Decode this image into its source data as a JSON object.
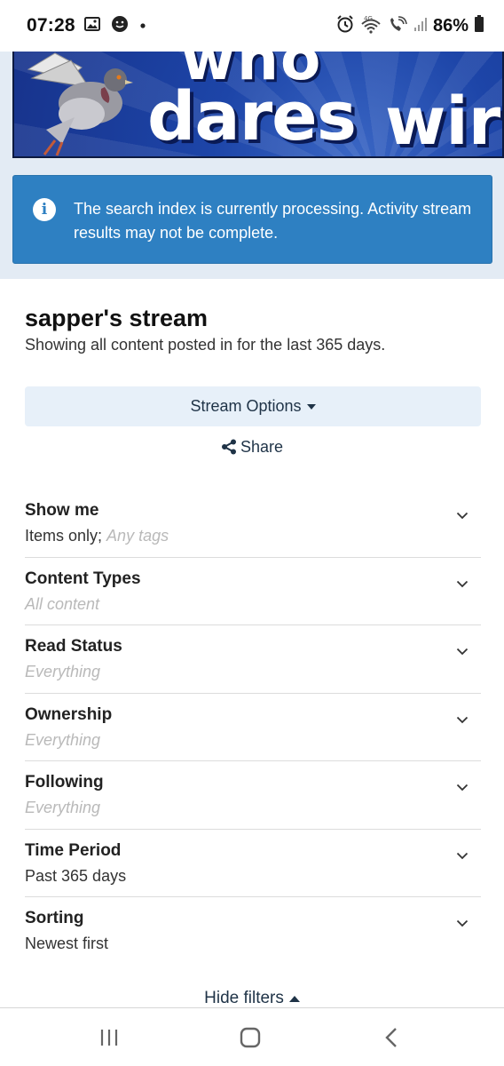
{
  "status_bar": {
    "time": "07:28",
    "battery": "86%",
    "network": "4G"
  },
  "banner": {
    "word_who": "who",
    "word_dares": "dares",
    "word_wins": "wir"
  },
  "alert": {
    "icon": "info-icon",
    "message": "The search index is currently processing. Activity stream results may not be complete.",
    "color": "#2e80c2"
  },
  "page": {
    "title": "sapper's stream",
    "subtitle": "Showing all content posted in for the last 365 days."
  },
  "actions": {
    "stream_options_label": "Stream Options",
    "share_label": "Share"
  },
  "filters": [
    {
      "label": "Show me",
      "value": "Items only;",
      "value_muted": "Any tags"
    },
    {
      "label": "Content Types",
      "value": "",
      "value_muted": "All content"
    },
    {
      "label": "Read Status",
      "value": "",
      "value_muted": "Everything"
    },
    {
      "label": "Ownership",
      "value": "",
      "value_muted": "Everything"
    },
    {
      "label": "Following",
      "value": "",
      "value_muted": "Everything"
    },
    {
      "label": "Time Period",
      "value": "Past 365 days",
      "value_muted": ""
    },
    {
      "label": "Sorting",
      "value": "Newest first",
      "value_muted": ""
    }
  ],
  "hide_filters_label": "Hide filters",
  "nav": {
    "recents_icon": "recents-icon",
    "home_icon": "home-icon",
    "back_icon": "back-icon"
  }
}
